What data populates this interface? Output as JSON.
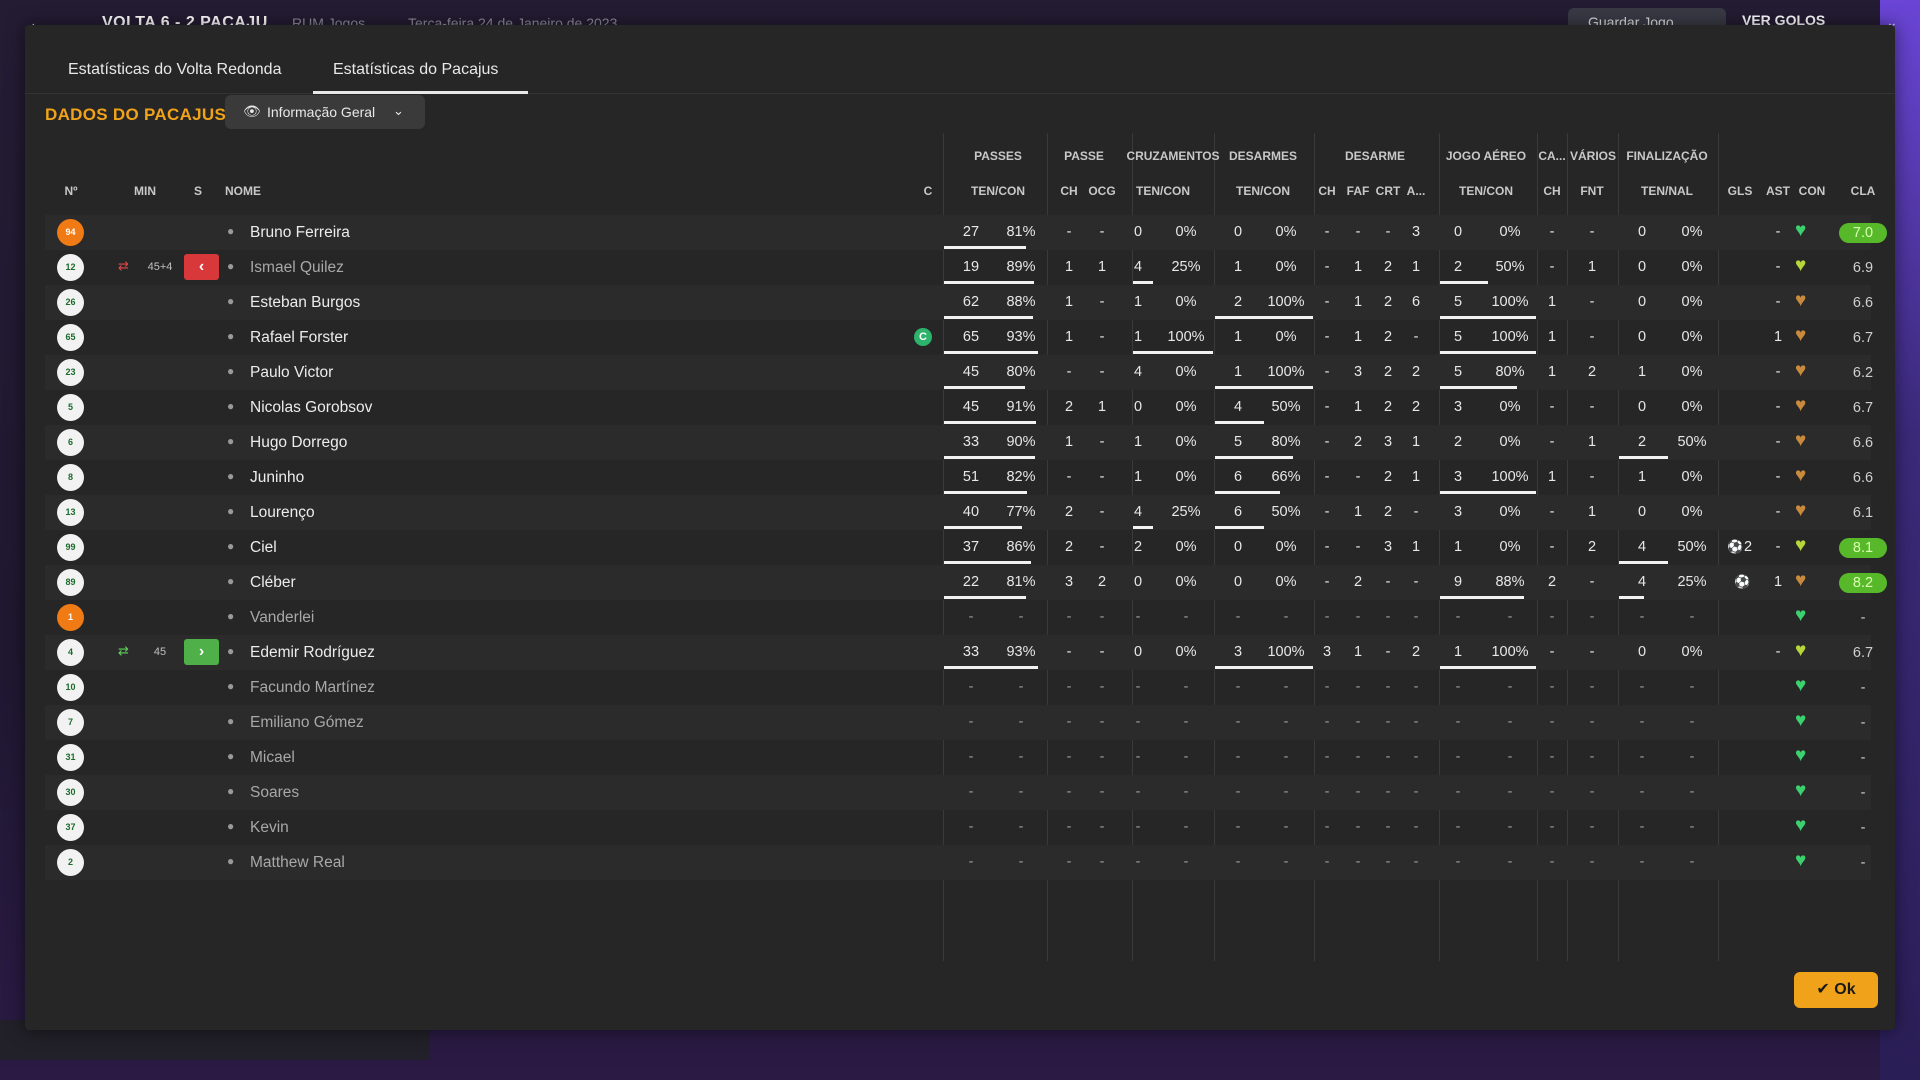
{
  "background": {
    "back_icon": "←",
    "match_title": "VOLTA 6 - 2 PACAJU",
    "match_sub": "RUM Jogos",
    "match_date": "Terça-feira 24 de Janeiro de 2023",
    "save_label": "Guardar Jogo",
    "goals_label": "VER GOLOS"
  },
  "tabs": [
    {
      "label": "Estatísticas do Volta Redonda"
    },
    {
      "label": "Estatísticas do Pacajus"
    }
  ],
  "section_title": "DADOS DO PACAJUS",
  "view_select": {
    "label": "Informação Geral",
    "icon": "eye-icon"
  },
  "group_headers": [
    "PASSES",
    "PASSE",
    "CRUZAMENTOS",
    "DESARMES",
    "DESARME",
    "JOGO AÉREO",
    "CA...",
    "VÁRIOS",
    "FINALIZAÇÃO"
  ],
  "column_headers": {
    "num": "Nº",
    "min": "MIN",
    "s": "S",
    "name": "NOME",
    "c": "C",
    "passes": "TEN/CON",
    "passe_ch": "CH",
    "passe_ocg": "OCG",
    "cruz": "TEN/CON",
    "desarmes": "TEN/CON",
    "des_ch": "CH",
    "des_faf": "FAF",
    "des_crt": "CRT",
    "des_a": "A...",
    "aereo": "TEN/CON",
    "ca_ch": "CH",
    "var_fnt": "FNT",
    "fin": "TEN/NAL",
    "gls": "GLS",
    "ast": "AST",
    "con": "CON",
    "cla": "CLA"
  },
  "colors": {
    "accent": "#f0a21a",
    "heart_green": "#3bd16f",
    "heart_yellow": "#b7d63a",
    "heart_orange": "#c98a3c",
    "rating_good": "#57b82a"
  },
  "players": [
    {
      "num": "94",
      "gk": true,
      "name": "Bruno Ferreira",
      "dim": false,
      "sub": null,
      "cap": false,
      "pas": [
        "27",
        "81%"
      ],
      "pch": "-",
      "ocg": "-",
      "cruz": [
        "0",
        "0%"
      ],
      "des": [
        "0",
        "0%"
      ],
      "dch": "-",
      "faf": "-",
      "crt": "-",
      "da": "3",
      "aer": [
        "0",
        "0%"
      ],
      "cach": "-",
      "fnt": "-",
      "fin": [
        "0",
        "0%"
      ],
      "gls": "",
      "ast": "-",
      "heart": "green",
      "cla": "7.0",
      "good": true,
      "bars": {
        "pas": 0.81,
        "cruz": 0,
        "des": 0,
        "aer": 0,
        "fin": 0
      }
    },
    {
      "num": "12",
      "gk": false,
      "name": "Ismael Quilez",
      "dim": true,
      "sub": {
        "type": "out",
        "min": "45+4"
      },
      "cap": false,
      "pas": [
        "19",
        "89%"
      ],
      "pch": "1",
      "ocg": "1",
      "cruz": [
        "4",
        "25%"
      ],
      "des": [
        "1",
        "0%"
      ],
      "dch": "-",
      "faf": "1",
      "crt": "2",
      "da": "1",
      "aer": [
        "2",
        "50%"
      ],
      "cach": "-",
      "fnt": "1",
      "fin": [
        "0",
        "0%"
      ],
      "gls": "",
      "ast": "-",
      "heart": "yellow",
      "cla": "6.9",
      "good": false,
      "bars": {
        "pas": 0.89,
        "cruz": 0.25,
        "des": 0,
        "aer": 0.5,
        "fin": 0
      }
    },
    {
      "num": "26",
      "gk": false,
      "name": "Esteban Burgos",
      "dim": false,
      "sub": null,
      "cap": false,
      "pas": [
        "62",
        "88%"
      ],
      "pch": "1",
      "ocg": "-",
      "cruz": [
        "1",
        "0%"
      ],
      "des": [
        "2",
        "100%"
      ],
      "dch": "-",
      "faf": "1",
      "crt": "2",
      "da": "6",
      "aer": [
        "5",
        "100%"
      ],
      "cach": "1",
      "fnt": "-",
      "fin": [
        "0",
        "0%"
      ],
      "gls": "",
      "ast": "-",
      "heart": "orange",
      "cla": "6.6",
      "good": false,
      "bars": {
        "pas": 0.88,
        "cruz": 0,
        "des": 1,
        "aer": 1,
        "fin": 0
      }
    },
    {
      "num": "65",
      "gk": false,
      "name": "Rafael Forster",
      "dim": false,
      "sub": null,
      "cap": true,
      "pas": [
        "65",
        "93%"
      ],
      "pch": "1",
      "ocg": "-",
      "cruz": [
        "1",
        "100%"
      ],
      "des": [
        "1",
        "0%"
      ],
      "dch": "-",
      "faf": "1",
      "crt": "2",
      "da": "-",
      "aer": [
        "5",
        "100%"
      ],
      "cach": "1",
      "fnt": "-",
      "fin": [
        "0",
        "0%"
      ],
      "gls": "",
      "ast": "1",
      "heart": "orange",
      "cla": "6.7",
      "good": false,
      "bars": {
        "pas": 0.93,
        "cruz": 1,
        "des": 0,
        "aer": 1,
        "fin": 0
      }
    },
    {
      "num": "23",
      "gk": false,
      "name": "Paulo Victor",
      "dim": false,
      "sub": null,
      "cap": false,
      "pas": [
        "45",
        "80%"
      ],
      "pch": "-",
      "ocg": "-",
      "cruz": [
        "4",
        "0%"
      ],
      "des": [
        "1",
        "100%"
      ],
      "dch": "-",
      "faf": "3",
      "crt": "2",
      "da": "2",
      "aer": [
        "5",
        "80%"
      ],
      "cach": "1",
      "fnt": "2",
      "fin": [
        "1",
        "0%"
      ],
      "gls": "",
      "ast": "-",
      "heart": "orange",
      "cla": "6.2",
      "good": false,
      "bars": {
        "pas": 0.8,
        "cruz": 0,
        "des": 1,
        "aer": 0.8,
        "fin": 0
      }
    },
    {
      "num": "5",
      "gk": false,
      "name": "Nicolas Gorobsov",
      "dim": false,
      "sub": null,
      "cap": false,
      "pas": [
        "45",
        "91%"
      ],
      "pch": "2",
      "ocg": "1",
      "cruz": [
        "0",
        "0%"
      ],
      "des": [
        "4",
        "50%"
      ],
      "dch": "-",
      "faf": "1",
      "crt": "2",
      "da": "2",
      "aer": [
        "3",
        "0%"
      ],
      "cach": "-",
      "fnt": "-",
      "fin": [
        "0",
        "0%"
      ],
      "gls": "",
      "ast": "-",
      "heart": "orange",
      "cla": "6.7",
      "good": false,
      "bars": {
        "pas": 0.91,
        "cruz": 0,
        "des": 0.5,
        "aer": 0,
        "fin": 0
      }
    },
    {
      "num": "6",
      "gk": false,
      "name": "Hugo Dorrego",
      "dim": false,
      "sub": null,
      "cap": false,
      "pas": [
        "33",
        "90%"
      ],
      "pch": "1",
      "ocg": "-",
      "cruz": [
        "1",
        "0%"
      ],
      "des": [
        "5",
        "80%"
      ],
      "dch": "-",
      "faf": "2",
      "crt": "3",
      "da": "1",
      "aer": [
        "2",
        "0%"
      ],
      "cach": "-",
      "fnt": "1",
      "fin": [
        "2",
        "50%"
      ],
      "gls": "",
      "ast": "-",
      "heart": "orange",
      "cla": "6.6",
      "good": false,
      "bars": {
        "pas": 0.9,
        "cruz": 0,
        "des": 0.8,
        "aer": 0,
        "fin": 0.5
      }
    },
    {
      "num": "8",
      "gk": false,
      "name": "Juninho",
      "dim": false,
      "sub": null,
      "cap": false,
      "pas": [
        "51",
        "82%"
      ],
      "pch": "-",
      "ocg": "-",
      "cruz": [
        "1",
        "0%"
      ],
      "des": [
        "6",
        "66%"
      ],
      "dch": "-",
      "faf": "-",
      "crt": "2",
      "da": "1",
      "aer": [
        "3",
        "100%"
      ],
      "cach": "1",
      "fnt": "-",
      "fin": [
        "1",
        "0%"
      ],
      "gls": "",
      "ast": "-",
      "heart": "orange",
      "cla": "6.6",
      "good": false,
      "bars": {
        "pas": 0.82,
        "cruz": 0,
        "des": 0.66,
        "aer": 1,
        "fin": 0
      }
    },
    {
      "num": "13",
      "gk": false,
      "name": "Lourenço",
      "dim": false,
      "sub": null,
      "cap": false,
      "pas": [
        "40",
        "77%"
      ],
      "pch": "2",
      "ocg": "-",
      "cruz": [
        "4",
        "25%"
      ],
      "des": [
        "6",
        "50%"
      ],
      "dch": "-",
      "faf": "1",
      "crt": "2",
      "da": "-",
      "aer": [
        "3",
        "0%"
      ],
      "cach": "-",
      "fnt": "1",
      "fin": [
        "0",
        "0%"
      ],
      "gls": "",
      "ast": "-",
      "heart": "orange",
      "cla": "6.1",
      "good": false,
      "bars": {
        "pas": 0.77,
        "cruz": 0.25,
        "des": 0.5,
        "aer": 0,
        "fin": 0
      }
    },
    {
      "num": "99",
      "gk": false,
      "name": "Ciel",
      "dim": false,
      "sub": null,
      "cap": false,
      "pas": [
        "37",
        "86%"
      ],
      "pch": "2",
      "ocg": "-",
      "cruz": [
        "2",
        "0%"
      ],
      "des": [
        "0",
        "0%"
      ],
      "dch": "-",
      "faf": "-",
      "crt": "3",
      "da": "1",
      "aer": [
        "1",
        "0%"
      ],
      "cach": "-",
      "fnt": "2",
      "fin": [
        "4",
        "50%"
      ],
      "gls": "2",
      "ast": "-",
      "heart": "yellow",
      "cla": "8.1",
      "good": true,
      "bars": {
        "pas": 0.86,
        "cruz": 0,
        "des": 0,
        "aer": 0,
        "fin": 0.5
      }
    },
    {
      "num": "89",
      "gk": false,
      "name": "Cléber",
      "dim": false,
      "sub": null,
      "cap": false,
      "pas": [
        "22",
        "81%"
      ],
      "pch": "3",
      "ocg": "2",
      "cruz": [
        "0",
        "0%"
      ],
      "des": [
        "0",
        "0%"
      ],
      "dch": "-",
      "faf": "2",
      "crt": "-",
      "da": "-",
      "aer": [
        "9",
        "88%"
      ],
      "cach": "2",
      "fnt": "-",
      "fin": [
        "4",
        "25%"
      ],
      "gls": "",
      "ast": "1",
      "heart": "orange",
      "cla": "8.2",
      "good": true,
      "bars": {
        "pas": 0.81,
        "cruz": 0,
        "des": 0,
        "aer": 0.88,
        "fin": 0.25
      }
    },
    {
      "num": "1",
      "gk": true,
      "name": "Vanderlei",
      "dim": true,
      "sub": null,
      "cap": false,
      "empty": true,
      "heart": "green",
      "cla": "-",
      "good": false
    },
    {
      "num": "4",
      "gk": false,
      "name": "Edemir Rodríguez",
      "dim": false,
      "sub": {
        "type": "in",
        "min": "45"
      },
      "cap": false,
      "pas": [
        "33",
        "93%"
      ],
      "pch": "-",
      "ocg": "-",
      "cruz": [
        "0",
        "0%"
      ],
      "des": [
        "3",
        "100%"
      ],
      "dch": "3",
      "faf": "1",
      "crt": "-",
      "da": "2",
      "aer": [
        "1",
        "100%"
      ],
      "cach": "-",
      "fnt": "-",
      "fin": [
        "0",
        "0%"
      ],
      "gls": "",
      "ast": "-",
      "heart": "yellow",
      "cla": "6.7",
      "good": false,
      "bars": {
        "pas": 0.93,
        "cruz": 0,
        "des": 1,
        "aer": 1,
        "fin": 0
      }
    },
    {
      "num": "10",
      "gk": false,
      "name": "Facundo Martínez",
      "dim": true,
      "sub": null,
      "cap": false,
      "empty": true,
      "heart": "green",
      "cla": "-",
      "good": false
    },
    {
      "num": "7",
      "gk": false,
      "name": "Emiliano Gómez",
      "dim": true,
      "sub": null,
      "cap": false,
      "empty": true,
      "heart": "green",
      "cla": "-",
      "good": false
    },
    {
      "num": "31",
      "gk": false,
      "name": "Micael",
      "dim": true,
      "sub": null,
      "cap": false,
      "empty": true,
      "heart": "green",
      "cla": "-",
      "good": false
    },
    {
      "num": "30",
      "gk": false,
      "name": "Soares",
      "dim": true,
      "sub": null,
      "cap": false,
      "empty": true,
      "heart": "green",
      "cla": "-",
      "good": false
    },
    {
      "num": "37",
      "gk": false,
      "name": "Kevin",
      "dim": true,
      "sub": null,
      "cap": false,
      "empty": true,
      "heart": "green",
      "cla": "-",
      "good": false
    },
    {
      "num": "2",
      "gk": false,
      "name": "Matthew Real",
      "dim": true,
      "sub": null,
      "cap": false,
      "empty": true,
      "heart": "green",
      "cla": "-",
      "good": false
    }
  ],
  "ok_label": "Ok"
}
